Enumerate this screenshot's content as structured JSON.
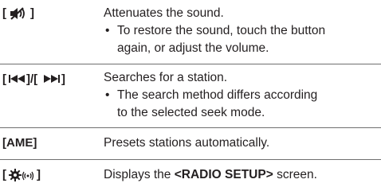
{
  "rows": [
    {
      "key_open": "[",
      "key_icon": "mute-speaker-icon",
      "key_close": "]",
      "description": "Attenuates the sound.",
      "bullet_line1": "To restore the sound, touch the button",
      "bullet_line2": "again, or adjust the volume."
    },
    {
      "key_label": "[◄◄]/[►►]",
      "key_icon": "seek-icons",
      "description": "Searches for a station.",
      "bullet_line1": "The search method differs according",
      "bullet_line2": "to the selected seek mode."
    },
    {
      "key_label": "[AME]",
      "description": "Presets stations automatically."
    },
    {
      "key_open": "[",
      "key_icon": "radio-setup-gear-icon",
      "key_close": "]",
      "description_prefix": "Displays the ",
      "description_bold": "<RADIO SETUP>",
      "description_suffix": " screen."
    }
  ],
  "bullet_char": "•"
}
